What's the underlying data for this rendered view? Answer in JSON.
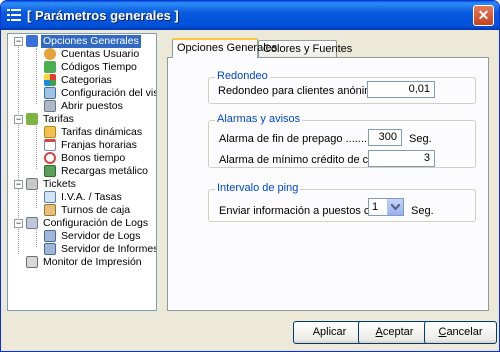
{
  "window": {
    "title": "[ Parámetros generales ]",
    "close_glyph": "✕"
  },
  "tree": {
    "items": [
      {
        "label": "Opciones Generales",
        "icon": "settings-icon"
      },
      {
        "label": "Cuentas Usuario",
        "icon": "users-icon"
      },
      {
        "label": "Códigos Tiempo",
        "icon": "codes-icon"
      },
      {
        "label": "Categorias",
        "icon": "categories-icon"
      },
      {
        "label": "Configuración del visor",
        "icon": "monitor-icon"
      },
      {
        "label": "Abrir puestos",
        "icon": "open-icon"
      },
      {
        "label": "Tarifas",
        "icon": "rates-icon"
      },
      {
        "label": "Tarifas dinámicas",
        "icon": "dynamic-rates-icon"
      },
      {
        "label": "Franjas horarias",
        "icon": "calendar-icon"
      },
      {
        "label": "Bonos tiempo",
        "icon": "clock-icon"
      },
      {
        "label": "Recargas metálico",
        "icon": "money-icon"
      },
      {
        "label": "Tickets",
        "icon": "tickets-icon"
      },
      {
        "label": "I.V.A. / Tasas",
        "icon": "tax-icon"
      },
      {
        "label": "Turnos de caja",
        "icon": "cashbox-icon"
      },
      {
        "label": "Configuración de Logs",
        "icon": "logs-icon"
      },
      {
        "label": "Servidor de Logs",
        "icon": "server-icon"
      },
      {
        "label": "Servidor de Informes",
        "icon": "server-icon"
      },
      {
        "label": "Monitor de Impresión",
        "icon": "printer-icon"
      }
    ]
  },
  "tabs": [
    {
      "label": "Opciones Generales"
    },
    {
      "label": "Colores y Fuentes"
    }
  ],
  "groups": {
    "redondeo": {
      "title": "Redondeo",
      "label": "Redondeo para clientes anónimos...",
      "value": "0,01"
    },
    "alarmas": {
      "title": "Alarmas y avisos",
      "prepago_label": "Alarma de fin de prepago ..............",
      "prepago_value": "300",
      "prepago_unit": "Seg.",
      "credito_label": "Alarma de mínimo crédito de cliente .",
      "credito_value": "3"
    },
    "ping": {
      "title": "Intervalo de ping",
      "label": "Enviar información a puestos cada ..",
      "value": "1",
      "unit": "Seg."
    }
  },
  "buttons": {
    "aplicar": "Aplicar",
    "aceptar_first": "A",
    "aceptar_rest": "ceptar",
    "cancelar_first": "C",
    "cancelar_rest": "ancelar"
  },
  "colors": {
    "title_bar": "#0a5ae0",
    "selection": "#316ac5",
    "group_title": "#0046d5"
  }
}
